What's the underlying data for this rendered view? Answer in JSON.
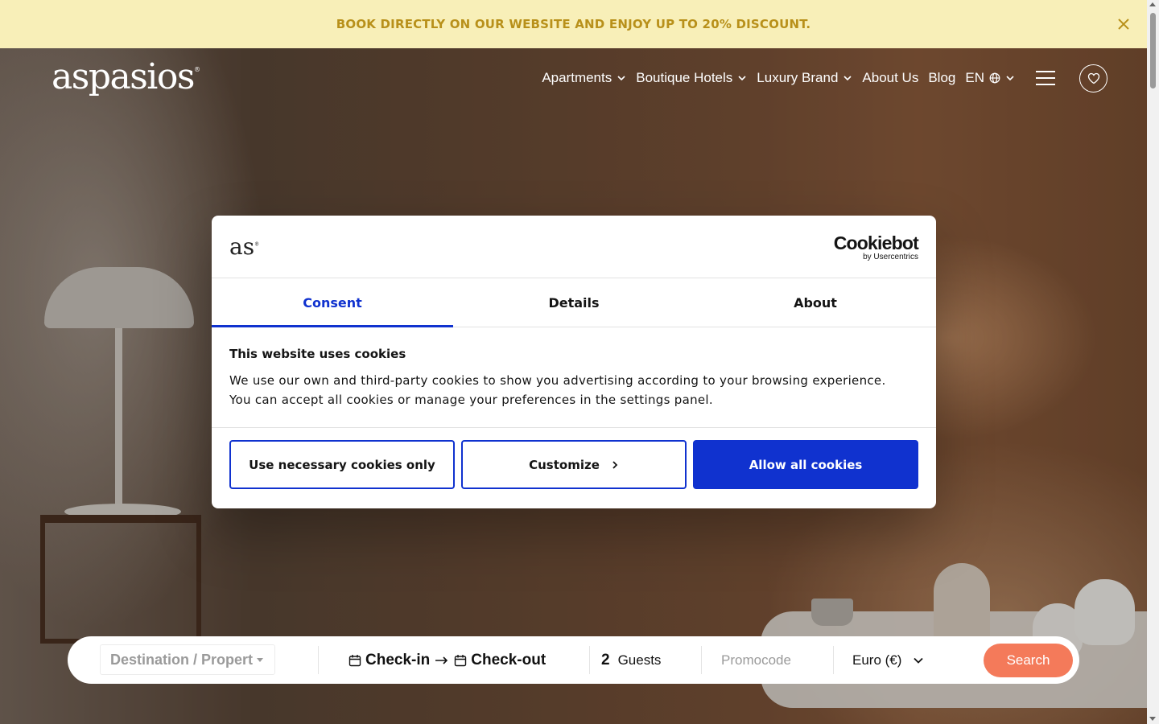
{
  "promo_banner": {
    "text": "BOOK DIRECTLY ON OUR WEBSITE AND ENJOY UP TO 20% DISCOUNT.",
    "text_color": "#b8901a",
    "background": "#f8efb8"
  },
  "header": {
    "logo": "aspasios",
    "nav": {
      "apartments": "Apartments",
      "boutique_hotels": "Boutique Hotels",
      "luxury_brand": "Luxury Brand",
      "about_us": "About Us",
      "blog": "Blog",
      "language": "EN"
    }
  },
  "cookie_dialog": {
    "logo": "as",
    "provider_name": "Cookiebot",
    "provider_by": "by Usercentrics",
    "tabs": [
      "Consent",
      "Details",
      "About"
    ],
    "active_tab": "Consent",
    "title": "This website uses cookies",
    "text_line1": "We use our own and third-party cookies to show you advertising according to your browsing experience.",
    "text_line2": "You can accept all cookies or manage your preferences in the settings panel.",
    "buttons": {
      "necessary": "Use necessary cookies only",
      "customize": "Customize",
      "allow": "Allow all cookies"
    },
    "accent_color": "#1032cf"
  },
  "booking_bar": {
    "destination_placeholder": "Destination / Propert",
    "checkin": "Check-in",
    "checkout": "Check-out",
    "guests_count": "2",
    "guests_label": "Guests",
    "promocode_placeholder": "Promocode",
    "currency": "Euro (€)",
    "search_label": "Search",
    "search_color": "#f47a5a"
  }
}
